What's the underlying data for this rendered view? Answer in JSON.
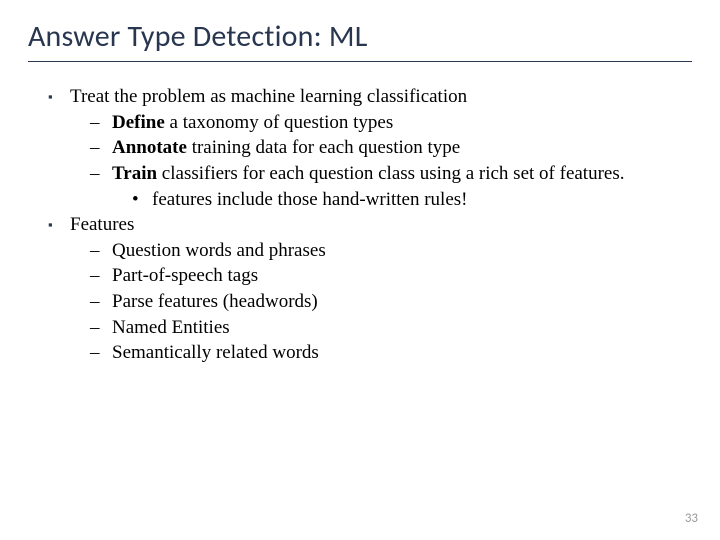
{
  "title": "Answer Type Detection: ML",
  "items": {
    "l1_0": "Treat the problem as machine learning classification",
    "l2_0_b": "Define",
    "l2_0_r": " a taxonomy of question types",
    "l2_1_b": "Annotate",
    "l2_1_r": " training data for each question type",
    "l2_2_b": "Train",
    "l2_2_r": " classifiers for each question class using a rich set of features.",
    "l3_0": "features include those hand-written rules!",
    "l1_1": "Features",
    "l2_3": "Question words and phrases",
    "l2_4": "Part-of-speech tags",
    "l2_5": "Parse features (headwords)",
    "l2_6": "Named Entities",
    "l2_7": "Semantically related words"
  },
  "pagenum": "33"
}
